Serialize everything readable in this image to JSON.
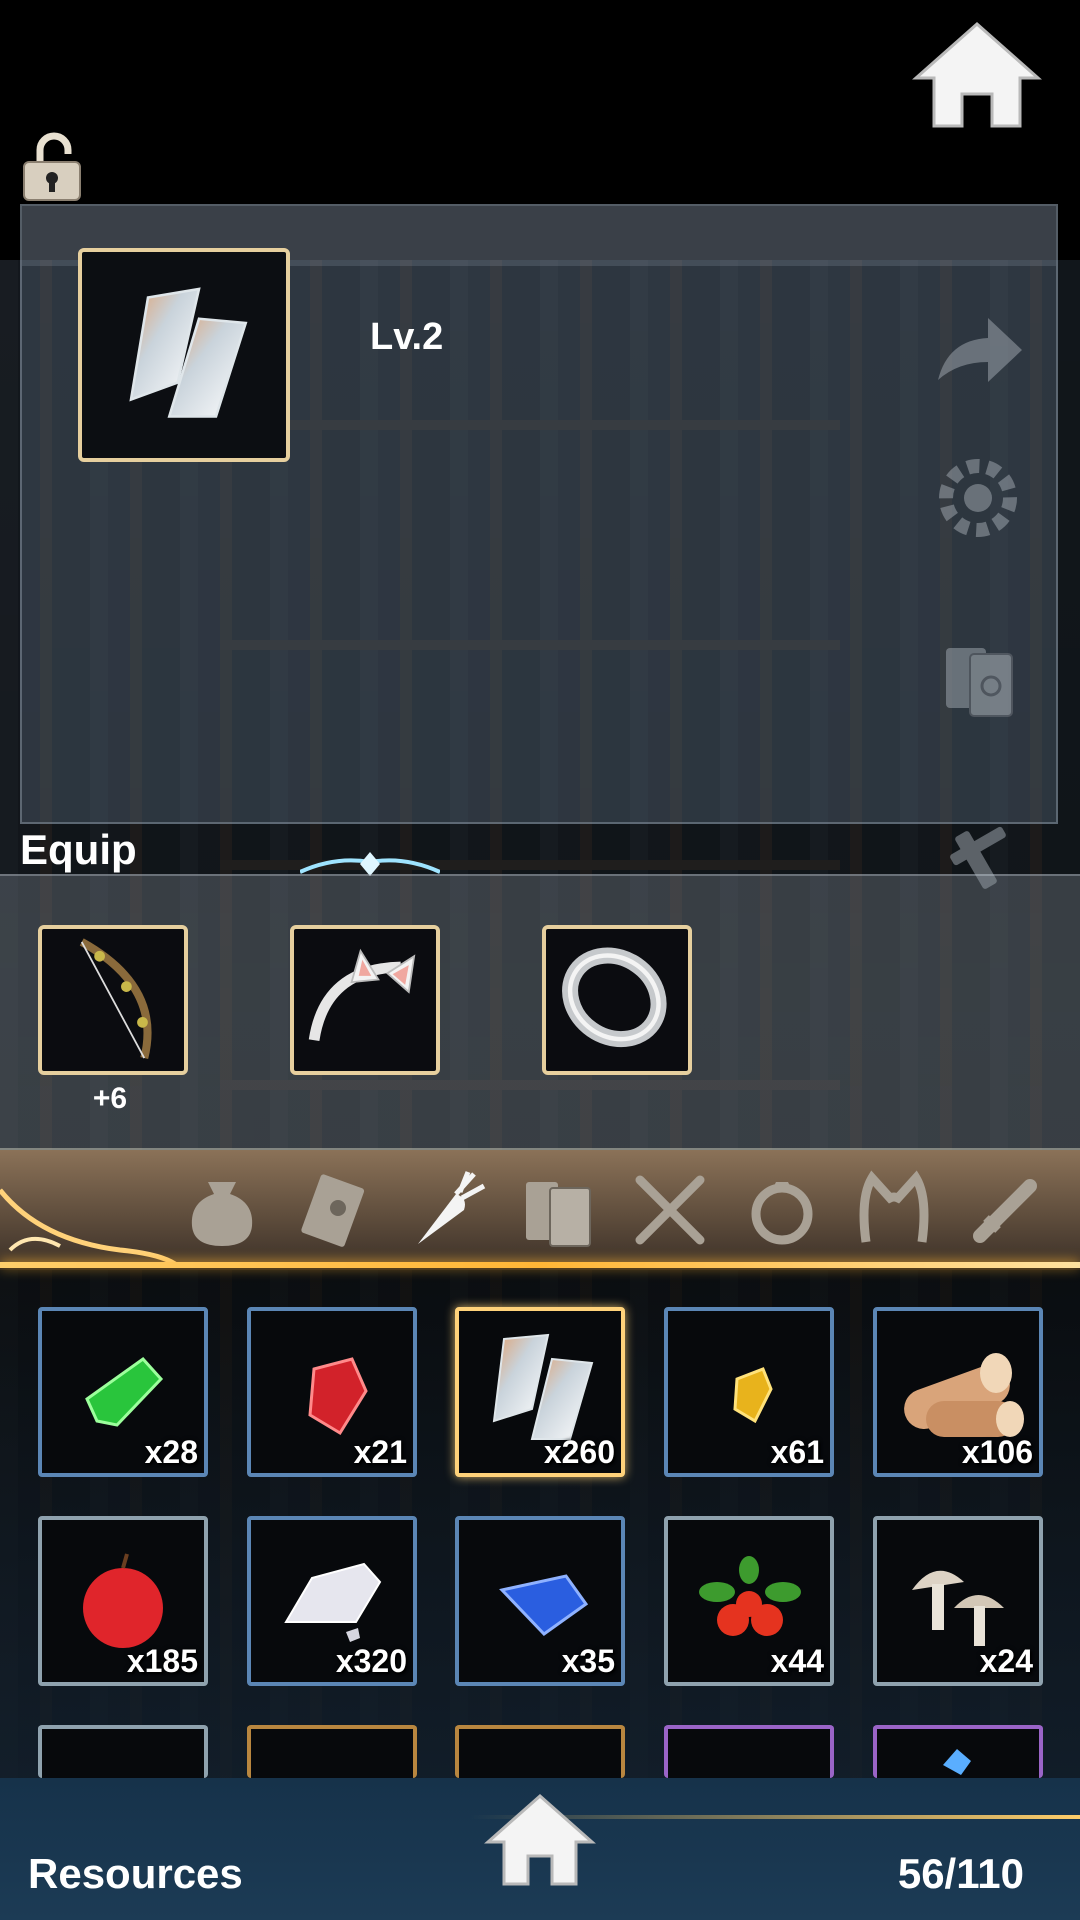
{
  "top": {
    "home_icon": "home-icon",
    "lock_icon": "unlocked-padlock-icon"
  },
  "selected_item": {
    "icon": "silver-ingot-icon",
    "level": "Lv.2"
  },
  "side_icons": [
    "next-arrow-icon",
    "settings-gear-icon",
    "manual-book-icon",
    "crafting-hammer-icon"
  ],
  "equip": {
    "title": "Equip",
    "slots": [
      {
        "icon": "vine-bow-icon",
        "level": "+6"
      },
      {
        "icon": "cat-ear-headband-icon",
        "level": ""
      },
      {
        "icon": "silver-ring-icon",
        "level": ""
      }
    ]
  },
  "tabs": [
    "bag-icon",
    "letter-card-icon",
    "carrot-icon",
    "books-icon",
    "fork-spoon-icon",
    "ring-icon",
    "cat-ears-icon",
    "sword-icon"
  ],
  "active_tab": "carrot-icon",
  "inventory": [
    {
      "icon": "green-crystal-icon",
      "count": "x28"
    },
    {
      "icon": "red-crystal-icon",
      "count": "x21"
    },
    {
      "icon": "silver-ingot-icon",
      "count": "x260",
      "selected": true
    },
    {
      "icon": "gold-crystal-icon",
      "count": "x61"
    },
    {
      "icon": "wood-log-icon",
      "count": "x106"
    },
    {
      "icon": "apple-icon",
      "count": "x185"
    },
    {
      "icon": "silver-ore-icon",
      "count": "x320"
    },
    {
      "icon": "blue-crystal-icon",
      "count": "x35"
    },
    {
      "icon": "tomato-plant-icon",
      "count": "x44"
    },
    {
      "icon": "mushroom-icon",
      "count": "x24"
    }
  ],
  "footer": {
    "title": "Resources",
    "count": "56/110",
    "home_icon": "home-icon"
  },
  "colors": {
    "accent_gold": "#ffce6a",
    "frame_blue": "#5b86b5",
    "panel_frame": "#e6cf9e"
  }
}
